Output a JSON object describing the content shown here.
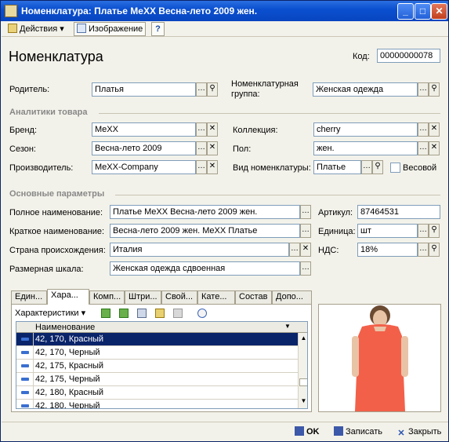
{
  "window": {
    "title": "Номенклатура: Платье MeXX Весна-лето 2009 жен.",
    "min": "_",
    "max": "□",
    "close": "✕"
  },
  "toolbar": {
    "actions": "Действия",
    "image": "Изображение",
    "help": "?"
  },
  "form": {
    "heading": "Номенклатура",
    "code_label": "Код:",
    "code": "00000000078",
    "parent_label": "Родитель:",
    "parent": "Платья",
    "group_label_1": "Номенклатурная",
    "group_label_2": "группа:",
    "group": "Женская одежда"
  },
  "analytics": {
    "title": "Аналитики товара",
    "brand_label": "Бренд:",
    "brand": "MeXX",
    "season_label": "Сезон:",
    "season": "Весна-лето 2009",
    "maker_label": "Производитель:",
    "maker": "MeXX-Company",
    "collection_label": "Коллекция:",
    "collection": "cherry",
    "sex_label": "Пол:",
    "sex": "жен.",
    "kind_label": "Вид номенклатуры:",
    "kind": "Платье",
    "weight_label": "Весовой"
  },
  "basic": {
    "title": "Основные параметры",
    "full_label": "Полное наименование:",
    "full": "Платье MeXX Весна-лето 2009 жен.",
    "short_label": "Краткое наименование:",
    "short": "Весна-лето 2009 жен. MeXX Платье",
    "country_label": "Страна происхождения:",
    "country": "Италия",
    "size_label": "Размерная шкала:",
    "size": "Женская одежда сдвоенная",
    "article_label": "Артикул:",
    "article": "87464531",
    "unit_label": "Единица:",
    "unit": "шт",
    "vat_label": "НДС:",
    "vat": "18%"
  },
  "tabs": [
    "Един...",
    "Хара...",
    "Комп...",
    "Штри...",
    "Свой...",
    "Кате...",
    "Состав",
    "Допо..."
  ],
  "table": {
    "menu": "Характеристики",
    "col_name": "Наименование",
    "rows": [
      "42, 170, Красный",
      "42, 170, Черный",
      "42, 175, Красный",
      "42, 175, Черный",
      "42, 180, Красный",
      "42, 180, Черный"
    ]
  },
  "status": {
    "ok": "OK",
    "save": "Записать",
    "close": "Закрыть"
  },
  "colors": {
    "title": "#0b50d0",
    "selection": "#0a246a",
    "dress": "#f2604a"
  }
}
